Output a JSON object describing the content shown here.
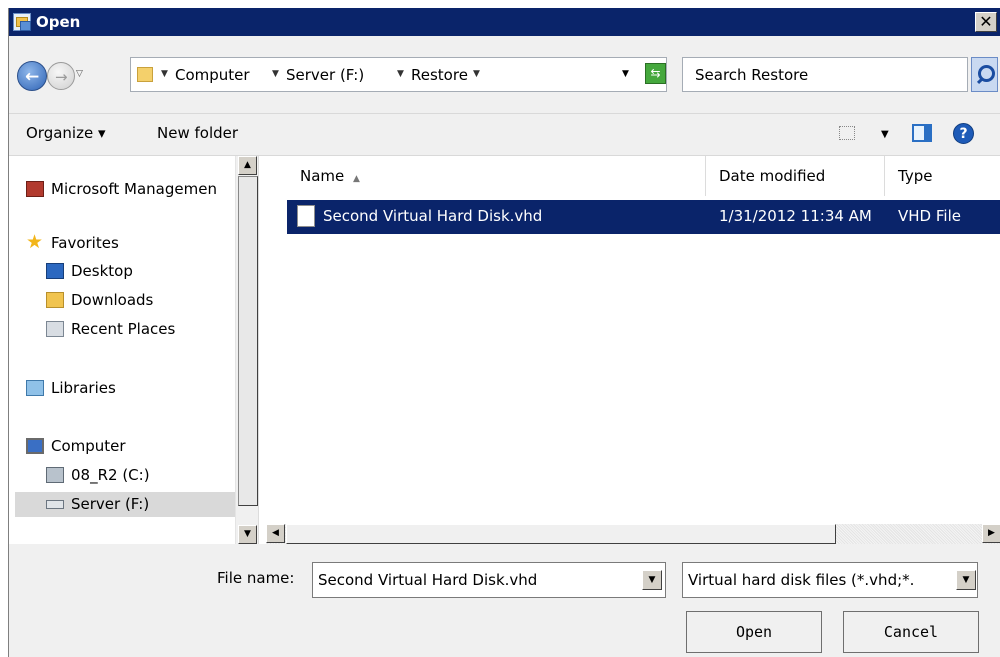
{
  "window": {
    "title": "Open",
    "close_label": "✕"
  },
  "nav": {
    "breadcrumbs": [
      "Computer",
      "Server (F:)",
      "Restore"
    ],
    "search_placeholder": "Search Restore"
  },
  "toolbar": {
    "organize_label": "Organize ▾",
    "new_folder_label": "New folder"
  },
  "sidebar": {
    "items": [
      {
        "label": "Microsoft Managemen",
        "icon": "management-console-icon"
      },
      {
        "label": "Favorites",
        "icon": "favorites-star-icon"
      },
      {
        "label": "Desktop",
        "icon": "desktop-icon"
      },
      {
        "label": "Downloads",
        "icon": "downloads-folder-icon"
      },
      {
        "label": "Recent Places",
        "icon": "recent-places-icon"
      },
      {
        "label": "Libraries",
        "icon": "libraries-icon"
      },
      {
        "label": "Computer",
        "icon": "computer-icon"
      },
      {
        "label": "08_R2 (C:)",
        "icon": "system-drive-icon"
      },
      {
        "label": "Server (F:)",
        "icon": "drive-icon"
      }
    ],
    "selected": "Server (F:)"
  },
  "filelist": {
    "columns": [
      "Name",
      "Date modified",
      "Type"
    ],
    "rows": [
      {
        "name": "Second Virtual Hard Disk.vhd",
        "date": "1/31/2012 11:34 AM",
        "type": "VHD File",
        "selected": true
      }
    ]
  },
  "bottom": {
    "filename_label": "File name:",
    "filename_value": "Second Virtual Hard Disk.vhd",
    "filetype_value": "Virtual hard disk files  (*.vhd;*.",
    "open_label": "Open",
    "cancel_label": "Cancel"
  },
  "colors": {
    "titlebar": "#0a246a",
    "selection": "#0a246a",
    "background": "#f0f0f0"
  }
}
